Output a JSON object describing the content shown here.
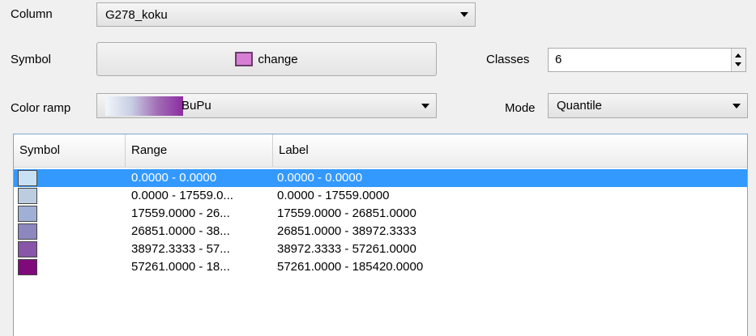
{
  "column": {
    "label": "Column",
    "value": "G278_koku"
  },
  "symbol": {
    "label": "Symbol",
    "button_text": "change",
    "swatch_color": "#d77fd4"
  },
  "classes": {
    "label": "Classes",
    "value": "6"
  },
  "color_ramp": {
    "label": "Color ramp",
    "value": "BuPu"
  },
  "mode": {
    "label": "Mode",
    "value": "Quantile"
  },
  "table": {
    "headers": [
      "Symbol",
      "Range",
      "Label"
    ],
    "rows": [
      {
        "color": "#c7e0f4",
        "range": "0.0000 - 0.0000",
        "label": "0.0000 - 0.0000",
        "selected": true
      },
      {
        "color": "#bccde0",
        "range": "0.0000 - 17559.0...",
        "label": "0.0000 - 17559.0000",
        "selected": false
      },
      {
        "color": "#a0b0d4",
        "range": "17559.0000 - 26...",
        "label": "17559.0000 - 26851.0000",
        "selected": false
      },
      {
        "color": "#8c88bf",
        "range": "26851.0000 - 38...",
        "label": "26851.0000 - 38972.3333",
        "selected": false
      },
      {
        "color": "#8855a8",
        "range": "38972.3333 - 57...",
        "label": "38972.3333 - 57261.0000",
        "selected": false
      },
      {
        "color": "#800a7c",
        "range": "57261.0000 - 18...",
        "label": "57261.0000 - 185420.0000",
        "selected": false
      }
    ]
  }
}
